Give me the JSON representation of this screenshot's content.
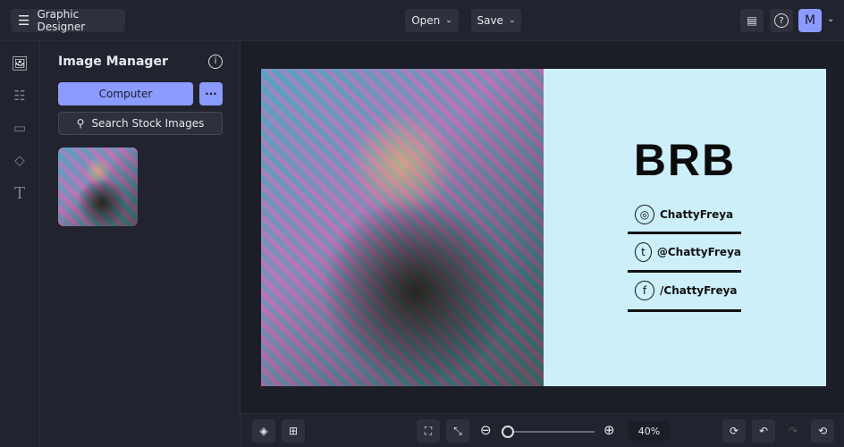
{
  "header": {
    "app_title": "Graphic Designer",
    "open_label": "Open",
    "save_label": "Save",
    "avatar_initial": "M"
  },
  "panel": {
    "title": "Image Manager",
    "computer_label": "Computer",
    "more_label": "···",
    "search_label": "Search Stock Images"
  },
  "design": {
    "title": "BRB",
    "socials": [
      {
        "icon": "instagram-icon",
        "handle": "ChattyFreya"
      },
      {
        "icon": "tumblr-icon",
        "handle": "@ChattyFreya"
      },
      {
        "icon": "facebook-icon",
        "handle": "/ChattyFreya"
      }
    ]
  },
  "toolbar": {
    "zoom_value": "40%",
    "zoom_fraction": 0.05
  },
  "colors": {
    "accent": "#8c9bff",
    "canvas_bg": "#cdeffa"
  }
}
